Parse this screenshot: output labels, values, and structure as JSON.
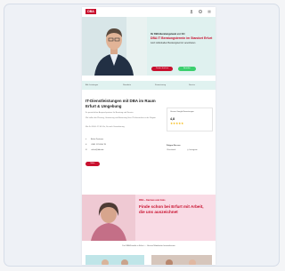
{
  "brand": {
    "logo_text": "DBA",
    "accent": "#c8102e"
  },
  "header": {
    "icons": [
      "user-icon",
      "info-icon",
      "menu-icon"
    ]
  },
  "hero": {
    "eyebrow": "Ihr DBA Beratungsteam vor Ort",
    "title": "DBA IT Beratungstermin im Standort Erfurt",
    "subtitle": "Jetzt individuellen Beratungstermin vereinbaren",
    "primary_button": "Termin buchen",
    "secondary_button": "Anrufen"
  },
  "nav": {
    "items": [
      "Alle Leistungen",
      "Standorte",
      "Finanzierung",
      "Service"
    ]
  },
  "main": {
    "title": "IT-Dienstleistungen mit DBA im Raum Erfurt & Umgebung",
    "intro": "Ihr persönlicher Ansprechpartner für Beratung und Service",
    "paragraph": "Wir helfen bei Planung, Umsetzung und Betreuung Ihrer IT-Infrastruktur in der Region.",
    "schedule": "Mo–Fr 08:00–17:00 Uhr, Sa nach Vereinbarung",
    "contacts": [
      {
        "icon": "location-icon",
        "text": "Erfurt Zentrum"
      },
      {
        "icon": "phone-icon",
        "text": "0361 123 456 78"
      },
      {
        "icon": "mail-icon",
        "text": "erfurt@dba.de"
      }
    ],
    "button": "Mehr",
    "rating_card": {
      "heading": "Unsere Google Bewertungen",
      "rating": "4,8",
      "stars": "★★★★★"
    },
    "social": {
      "heading": "Folgen Sie uns",
      "items": [
        "Facebook",
        "Instagram"
      ]
    }
  },
  "promo": {
    "label": "DBA – Karriere und Jobs",
    "title": "Finde schon bei Erfurt mit Arbeit, die uns auszeichnet"
  },
  "section": {
    "heading": "Die DBA Familie in Erfurt — Unsere Mitarbeiter kennenlernen"
  }
}
